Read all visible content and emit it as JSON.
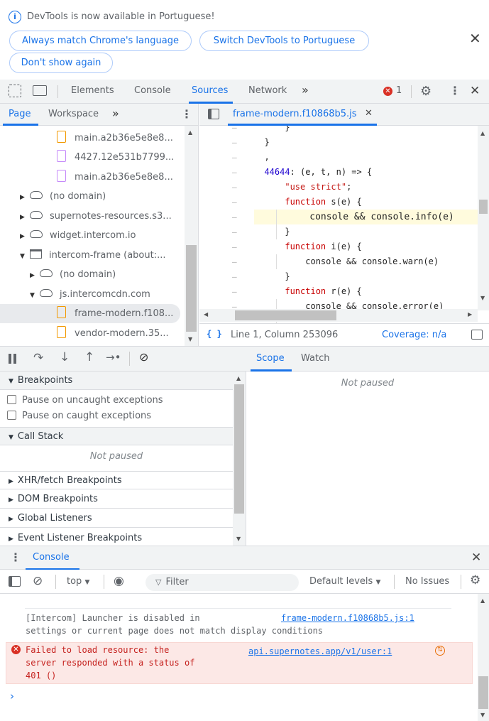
{
  "infobar": {
    "message": "DevTools is now available in Portuguese!",
    "buttons": [
      "Always match Chrome's language",
      "Switch DevTools to Portuguese",
      "Don't show again"
    ]
  },
  "main_tabs": [
    "Elements",
    "Console",
    "Sources",
    "Network"
  ],
  "active_main_tab": "Sources",
  "more_tabs_icon": "»",
  "error_count": "1",
  "navigator": {
    "tabs": [
      "Page",
      "Workspace"
    ],
    "active_tab": "Page",
    "tree": [
      {
        "label": "main.a2b36e5e8e8...",
        "kind": "file-orange"
      },
      {
        "label": "4427.12e531b7799...",
        "kind": "file-purple"
      },
      {
        "label": "main.a2b36e5e8e8...",
        "kind": "file-purple"
      },
      {
        "label": "(no domain)",
        "kind": "cloud"
      },
      {
        "label": "supernotes-resources.s3...",
        "kind": "cloud"
      },
      {
        "label": "widget.intercom.io",
        "kind": "cloud"
      },
      {
        "label": "intercom-frame (about:...",
        "kind": "frame"
      },
      {
        "label": "(no domain)",
        "kind": "cloud"
      },
      {
        "label": "js.intercomcdn.com",
        "kind": "cloud"
      },
      {
        "label": "frame-modern.f108...",
        "kind": "file-orange",
        "selected": true
      },
      {
        "label": "vendor-modern.35...",
        "kind": "file-orange"
      }
    ]
  },
  "editor": {
    "tab_title": "frame-modern.f10868b5.js",
    "code_lines": [
      {
        "text": "      }"
      },
      {
        "text": "  }"
      },
      {
        "text": "  ,"
      },
      {
        "text": "  44644: (e, t, n) => {"
      },
      {
        "text": "      \"use strict\";"
      },
      {
        "text": "      function s(e) {"
      },
      {
        "text": "          console && console.info(e)",
        "highlight": true
      },
      {
        "text": "      }"
      },
      {
        "text": "      function i(e) {"
      },
      {
        "text": "          console && console.warn(e)"
      },
      {
        "text": "      }"
      },
      {
        "text": "      function r(e) {"
      },
      {
        "text": "          console && console.error(e)"
      }
    ],
    "gutter_mark": "–",
    "status_position": "Line 1, Column 253096",
    "coverage": "Coverage: n/a",
    "format_icon": "{ }"
  },
  "debugger": {
    "sections": {
      "breakpoints": "Breakpoints",
      "pause_uncaught": "Pause on uncaught exceptions",
      "pause_caught": "Pause on caught exceptions",
      "call_stack": "Call Stack",
      "not_paused": "Not paused",
      "xhr": "XHR/fetch Breakpoints",
      "dom": "DOM Breakpoints",
      "global": "Global Listeners",
      "event": "Event Listener Breakpoints"
    },
    "scope_tabs": [
      "Scope",
      "Watch"
    ],
    "scope_status": "Not paused"
  },
  "console": {
    "drawer_tab": "Console",
    "context": "top",
    "filter_placeholder": "Filter",
    "levels": "Default levels",
    "issues": "No Issues",
    "messages": [
      {
        "level": "info",
        "text_lines": [
          "[Intercom] Launcher is disabled in",
          "settings or current page does not match display conditions"
        ],
        "source": "frame-modern.f10868b5.js:1"
      },
      {
        "level": "error",
        "text_lines": [
          "Failed to load resource: the",
          "server responded with a status of",
          "401 ()"
        ],
        "source": "api.supernotes.app/v1/user:1"
      }
    ],
    "prompt": "›"
  },
  "colors": {
    "accent": "#1a73e8",
    "error": "#d93025",
    "error_bg": "#fce8e6",
    "toolbar_bg": "#f1f3f4"
  }
}
